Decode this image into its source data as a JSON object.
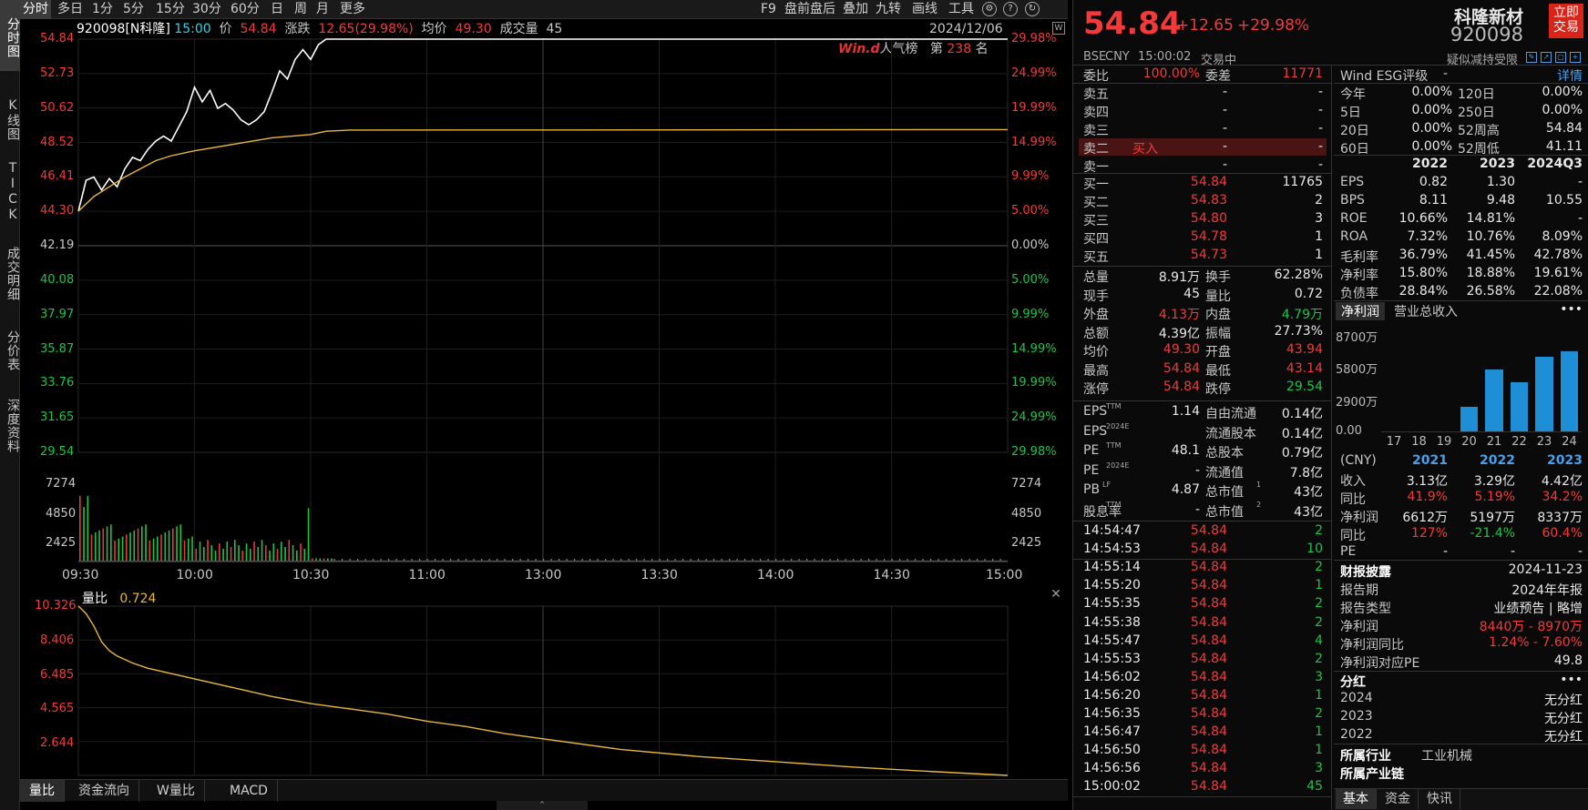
{
  "vtabs": [
    {
      "label": "分时图",
      "active": true
    },
    {
      "label": "K线图",
      "active": false
    },
    {
      "label": "TICK",
      "active": false
    },
    {
      "label": "成交明细",
      "active": false
    },
    {
      "label": "分价表",
      "active": false
    },
    {
      "label": "深度资料",
      "active": false
    }
  ],
  "toolbar": {
    "periods": [
      {
        "label": "分时",
        "active": true
      },
      {
        "label": "多日"
      },
      {
        "label": "1分"
      },
      {
        "label": "5分"
      },
      {
        "label": "15分"
      },
      {
        "label": "30分"
      },
      {
        "label": "60分"
      },
      {
        "label": "日"
      },
      {
        "label": "周"
      },
      {
        "label": "月"
      },
      {
        "label": "更多"
      }
    ],
    "tools": [
      "F9",
      "盘前盘后",
      "叠加",
      "九转",
      "画线",
      "工具"
    ]
  },
  "quote_line": {
    "code_name": "920098[N科隆]",
    "time": "15:00",
    "price_label": "价",
    "price": "54.84",
    "change_label": "涨跌",
    "change": "12.65(29.98%)",
    "avg_label": "均价",
    "avg": "49.30",
    "vol_label": "成交量",
    "vol": "45"
  },
  "date": "2024/12/06",
  "rank": {
    "brand": "Win.d",
    "label": "人气榜",
    "prefix": "第",
    "value": "238",
    "suffix": "名"
  },
  "price_axis_left": [
    "54.84",
    "52.73",
    "50.62",
    "48.52",
    "46.41",
    "44.30",
    "42.19",
    "40.08",
    "37.97",
    "35.87",
    "33.76",
    "31.65",
    "29.54"
  ],
  "price_axis_right": [
    "29.98%",
    "24.99%",
    "19.99%",
    "14.99%",
    "9.99%",
    "5.00%",
    "0.00%",
    "5.00%",
    "9.99%",
    "14.99%",
    "19.99%",
    "24.99%",
    "29.98%"
  ],
  "vol_axis": [
    "7274",
    "4850",
    "2425"
  ],
  "time_axis": [
    "09:30",
    "10:00",
    "10:30",
    "11:00",
    "13:00",
    "13:30",
    "14:00",
    "14:30",
    "15:00"
  ],
  "sub_chart": {
    "title": "量比",
    "value": "0.724",
    "axis": [
      "10.326",
      "8.406",
      "6.485",
      "4.565",
      "2.644"
    ]
  },
  "sub_tabs": [
    {
      "label": "量比",
      "active": true
    },
    {
      "label": "资金流向"
    },
    {
      "label": "W量比"
    },
    {
      "label": "MACD"
    }
  ],
  "header": {
    "price": "54.84",
    "change": "+12.65",
    "pct": "+29.98%",
    "name": "科隆新材",
    "code": "920098",
    "trade_btn": "立即交易",
    "market": "BSE",
    "currency": "CNY",
    "time": "15:00:02",
    "status": "交易中",
    "note": "疑似减持受限"
  },
  "weibi": {
    "label": "委比",
    "value": "100.00%",
    "diff_label": "委差",
    "diff": "11771"
  },
  "asks": [
    {
      "label": "卖五",
      "price": "-",
      "vol": "-"
    },
    {
      "label": "卖四",
      "price": "-",
      "vol": "-"
    },
    {
      "label": "卖三",
      "price": "-",
      "vol": "-"
    },
    {
      "label": "卖二",
      "price": "-",
      "vol": "-",
      "tag": "买入"
    },
    {
      "label": "卖一",
      "price": "-",
      "vol": "-"
    }
  ],
  "bids": [
    {
      "label": "买一",
      "price": "54.84",
      "vol": "11765"
    },
    {
      "label": "买二",
      "price": "54.83",
      "vol": "2"
    },
    {
      "label": "买三",
      "price": "54.80",
      "vol": "3"
    },
    {
      "label": "买四",
      "price": "54.78",
      "vol": "1"
    },
    {
      "label": "买五",
      "price": "54.73",
      "vol": "1"
    }
  ],
  "stats": [
    {
      "l1": "总量",
      "v1": "8.91万",
      "c1": "white",
      "l2": "换手",
      "v2": "62.28%",
      "c2": "white"
    },
    {
      "l1": "现手",
      "v1": "45",
      "c1": "white",
      "l2": "量比",
      "v2": "0.72",
      "c2": "white"
    },
    {
      "l1": "外盘",
      "v1": "4.13万",
      "c1": "red",
      "l2": "内盘",
      "v2": "4.79万",
      "c2": "green"
    },
    {
      "l1": "总额",
      "v1": "4.39亿",
      "c1": "white",
      "l2": "振幅",
      "v2": "27.73%",
      "c2": "white"
    },
    {
      "l1": "均价",
      "v1": "49.30",
      "c1": "red",
      "l2": "开盘",
      "v2": "43.94",
      "c2": "red"
    },
    {
      "l1": "最高",
      "v1": "54.84",
      "c1": "red",
      "l2": "最低",
      "v2": "43.14",
      "c2": "red"
    },
    {
      "l1": "涨停",
      "v1": "54.84",
      "c1": "red",
      "l2": "跌停",
      "v2": "29.54",
      "c2": "green"
    }
  ],
  "fundamentals": [
    {
      "l1": "EPS",
      "s1": "TTM",
      "v1": "1.14",
      "l2": "自由流通",
      "v2": "0.14亿"
    },
    {
      "l1": "EPS",
      "s1": "2024E",
      "v1": "",
      "l2": "流通股本",
      "v2": "0.14亿"
    },
    {
      "l1": "PE",
      "s1": "TTM",
      "v1": "48.1",
      "l2": "总股本",
      "v2": "0.79亿"
    },
    {
      "l1": "PE",
      "s1": "2024E",
      "v1": "-",
      "l2": "流通值",
      "v2": "7.8亿"
    },
    {
      "l1": "PB",
      "s1": "LF",
      "v1": "4.87",
      "l2": "总市值",
      "s2": "1",
      "v2": "43亿"
    },
    {
      "l1": "股息率",
      "s1": "TTM",
      "v1": "-",
      "l2": "总市值",
      "s2": "2",
      "v2": "43亿"
    }
  ],
  "ticks": [
    {
      "t": "14:54:47",
      "p": "54.84",
      "v": "2"
    },
    {
      "t": "14:54:53",
      "p": "54.84",
      "v": "10"
    },
    {
      "t": "14:55:14",
      "p": "54.84",
      "v": "2"
    },
    {
      "t": "14:55:20",
      "p": "54.84",
      "v": "1"
    },
    {
      "t": "14:55:35",
      "p": "54.84",
      "v": "2"
    },
    {
      "t": "14:55:38",
      "p": "54.84",
      "v": "2"
    },
    {
      "t": "14:55:47",
      "p": "54.84",
      "v": "4"
    },
    {
      "t": "14:55:53",
      "p": "54.84",
      "v": "2"
    },
    {
      "t": "14:56:02",
      "p": "54.84",
      "v": "3"
    },
    {
      "t": "14:56:20",
      "p": "54.84",
      "v": "1"
    },
    {
      "t": "14:56:35",
      "p": "54.84",
      "v": "2"
    },
    {
      "t": "14:56:47",
      "p": "54.84",
      "v": "1"
    },
    {
      "t": "14:56:50",
      "p": "54.84",
      "v": "1"
    },
    {
      "t": "14:56:56",
      "p": "54.84",
      "v": "3"
    },
    {
      "t": "15:00:02",
      "p": "54.84",
      "v": "45"
    }
  ],
  "esg": {
    "label": "Wind ESG评级",
    "value": "-",
    "link": "详情"
  },
  "returns": [
    {
      "l1": "今年",
      "v1": "0.00%",
      "l2": "120日",
      "v2": "0.00%"
    },
    {
      "l1": "5日",
      "v1": "0.00%",
      "l2": "250日",
      "v2": "0.00%"
    },
    {
      "l1": "20日",
      "v1": "0.00%",
      "l2": "52周高",
      "v2": "54.84"
    },
    {
      "l1": "60日",
      "v1": "0.00%",
      "l2": "52周低",
      "v2": "41.11"
    }
  ],
  "fin_table": {
    "years": [
      "2022",
      "2023",
      "2024Q3"
    ],
    "rows": [
      {
        "l": "EPS",
        "v": [
          "0.82",
          "1.30",
          "-"
        ]
      },
      {
        "l": "BPS",
        "v": [
          "8.11",
          "9.48",
          "10.55"
        ]
      },
      {
        "l": "ROE",
        "v": [
          "10.66%",
          "14.81%",
          "-"
        ]
      },
      {
        "l": "ROA",
        "v": [
          "7.32%",
          "10.76%",
          "8.09%"
        ]
      },
      {
        "l": "毛利率",
        "v": [
          "36.79%",
          "41.45%",
          "42.78%"
        ]
      },
      {
        "l": "净利率",
        "v": [
          "15.80%",
          "18.88%",
          "19.61%"
        ]
      },
      {
        "l": "负债率",
        "v": [
          "28.84%",
          "26.58%",
          "22.08%"
        ]
      }
    ]
  },
  "profit_tabs": {
    "active": "净利润",
    "other": "营业总收入",
    "more": "•••"
  },
  "chart_data": {
    "type": "bar",
    "categories": [
      "17",
      "18",
      "19",
      "20",
      "21",
      "22",
      "23",
      "24"
    ],
    "values": [
      0,
      0,
      0,
      2200,
      5600,
      4400,
      6700,
      7200
    ],
    "yticks": [
      "8700万",
      "5800万",
      "2900万",
      "0.00"
    ],
    "ylim": [
      0,
      8700
    ]
  },
  "annual": {
    "unit": "(CNY)",
    "years": [
      "2021",
      "2022",
      "2023"
    ],
    "rows": [
      {
        "l": "收入",
        "v": [
          "3.13亿",
          "3.29亿",
          "4.42亿"
        ],
        "c": "white"
      },
      {
        "l": "同比",
        "v": [
          "41.9%",
          "5.19%",
          "34.2%"
        ],
        "c": "red"
      },
      {
        "l": "净利润",
        "v": [
          "6612万",
          "5197万",
          "8337万"
        ],
        "c": "white"
      },
      {
        "l": "同比",
        "v": [
          "127%",
          "-21.4%",
          "60.4%"
        ],
        "c": "mixed"
      },
      {
        "l": "PE",
        "v": [
          "-",
          "-",
          "-"
        ],
        "c": "white"
      }
    ]
  },
  "report": {
    "title": "财报披露",
    "date": "2024-11-23",
    "rows": [
      {
        "l": "报告期",
        "v": "2024年年报"
      },
      {
        "l": "报告类型",
        "v": "业绩预告 | 略增"
      },
      {
        "l": "净利润",
        "v": "8440万 - 8970万"
      },
      {
        "l": "净利润同比",
        "v": "1.24% - 7.60%"
      },
      {
        "l": "净利润对应PE",
        "v": "49.8"
      }
    ]
  },
  "dividend": {
    "title": "分红",
    "more": "•••",
    "rows": [
      {
        "y": "2024",
        "v": "无分红"
      },
      {
        "y": "2023",
        "v": "无分红"
      },
      {
        "y": "2022",
        "v": "无分红"
      }
    ]
  },
  "industry": {
    "l": "所属行业",
    "v": "工业机械",
    "chain": "所属产业链"
  },
  "bottom_tabs": [
    {
      "label": "基本",
      "active": true
    },
    {
      "label": "资金"
    },
    {
      "label": "快讯"
    }
  ]
}
